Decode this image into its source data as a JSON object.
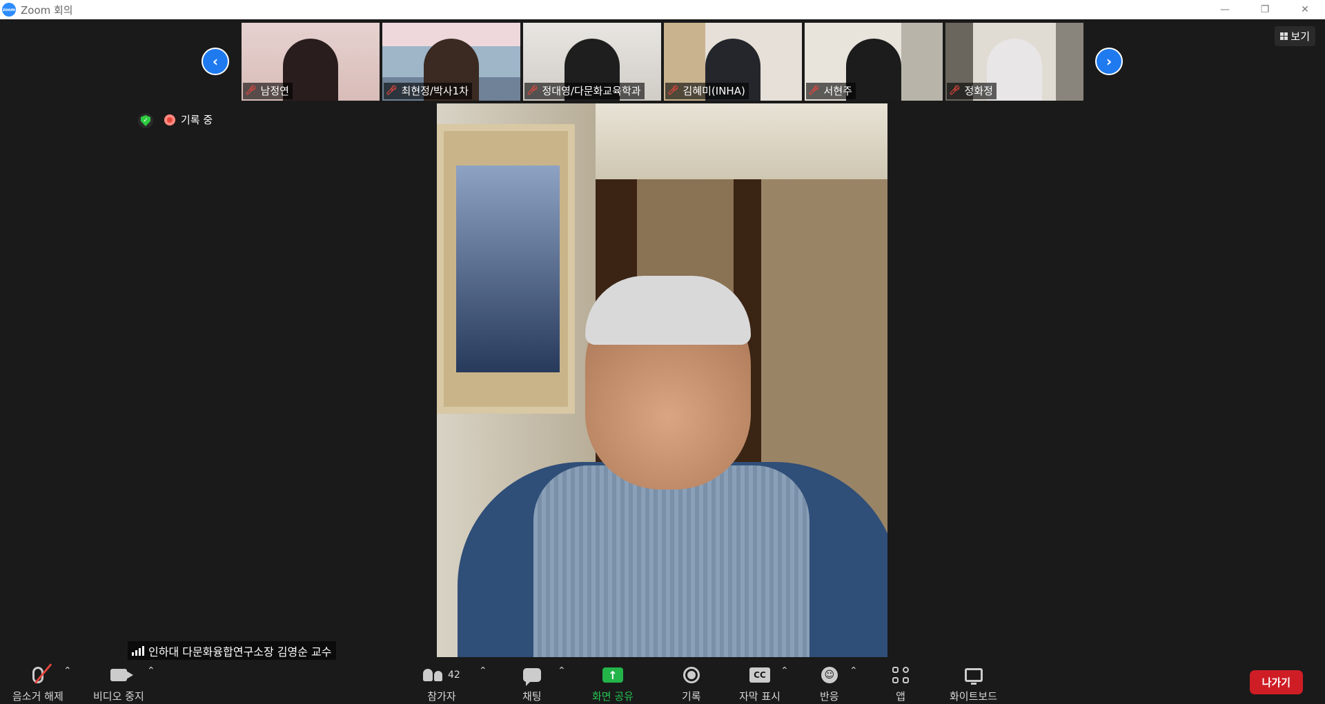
{
  "window": {
    "title": "Zoom 회의",
    "logo_text": "zoom",
    "controls": {
      "minimize": "—",
      "restore": "❐",
      "close": "✕"
    }
  },
  "nav": {
    "prev": "‹",
    "next": "›"
  },
  "thumbnails": [
    {
      "name": "남정연",
      "muted": true
    },
    {
      "name": "최현정/박사1차",
      "muted": true
    },
    {
      "name": "정대영/다문화교육학과",
      "muted": true
    },
    {
      "name": "김혜미(INHA)",
      "muted": true
    },
    {
      "name": "서현주",
      "muted": true
    },
    {
      "name": "정화정",
      "muted": true
    }
  ],
  "view_button": {
    "label": "보기"
  },
  "security": {
    "icon": "shield-check-icon"
  },
  "recording": {
    "label": "기록 중"
  },
  "active_speaker": {
    "name": "인하대 다문화융합연구소장 김영순 교수"
  },
  "toolbar": {
    "mute": {
      "label": "음소거 해제",
      "icon": "mic-off-icon"
    },
    "video": {
      "label": "비디오 중지",
      "icon": "camera-icon"
    },
    "participants": {
      "label": "참가자",
      "count": "42",
      "icon": "people-icon"
    },
    "chat": {
      "label": "채팅",
      "icon": "chat-icon"
    },
    "share": {
      "label": "화면 공유",
      "icon": "share-screen-icon",
      "color": "#23b44a"
    },
    "record": {
      "label": "기록",
      "icon": "record-icon"
    },
    "captions": {
      "label": "자막 표시",
      "icon": "cc-icon",
      "badge": "CC"
    },
    "reactions": {
      "label": "반응",
      "icon": "emoji-icon"
    },
    "apps": {
      "label": "앱",
      "icon": "apps-icon"
    },
    "whiteboard": {
      "label": "화이트보드",
      "icon": "whiteboard-icon"
    },
    "leave": {
      "label": "나가기",
      "color": "#cf1d26"
    },
    "caret": "⌃"
  }
}
